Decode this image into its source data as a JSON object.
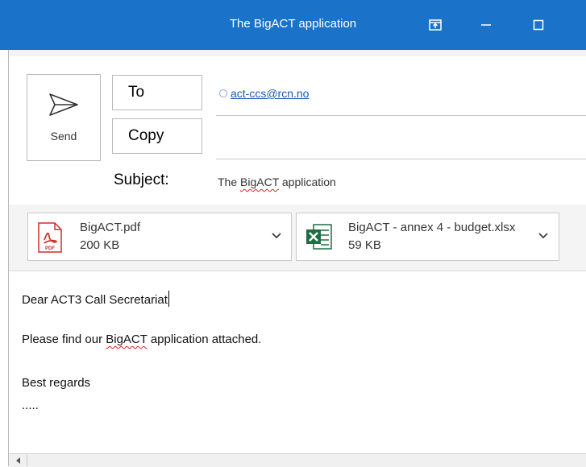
{
  "window": {
    "title": "The BigACT application",
    "restore_icon": "restore-icon",
    "minimize_icon": "minimize-icon",
    "maximize_icon": "maximize-icon",
    "accent_color": "#1a73c9"
  },
  "compose": {
    "send_label": "Send",
    "send_icon": "send-icon",
    "to_label": "To",
    "copy_label": "Copy",
    "to_recipient": "act-ccs@rcn.no",
    "copy_recipients": "",
    "subject_label": "Subject:",
    "subject_prefix": "The ",
    "subject_misspelled": "BigACT",
    "subject_suffix": " application"
  },
  "attachments": [
    {
      "name": "BigACT.pdf",
      "size": "200 KB",
      "icon": "pdf-icon"
    },
    {
      "name": "BigACT - annex 4 - budget.xlsx",
      "size": "59 KB",
      "icon": "excel-icon"
    }
  ],
  "body": {
    "line1": "Dear ACT3 Call Secretariat",
    "line2_prefix": "Please find our ",
    "line2_misspelled": "BigACT",
    "line2_suffix": " application attached.",
    "line3": "Best regards",
    "line4": "....."
  }
}
